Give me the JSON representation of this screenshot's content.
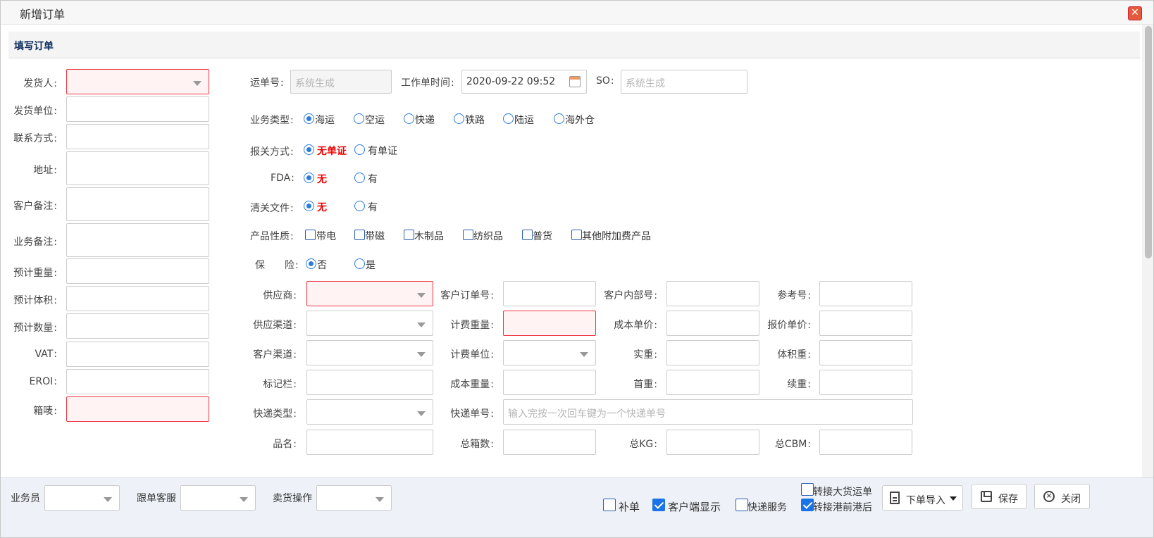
{
  "window": {
    "title": "新增订单"
  },
  "panel": {
    "title": "填写订单"
  },
  "left": {
    "shipper": "发货人",
    "shipper_unit": "发货单位",
    "contact": "联系方式",
    "address": "地址",
    "customer_note": "客户备注",
    "business_note": "业务备注",
    "est_weight": "预计重量",
    "est_volume": "预计体积",
    "est_qty": "预计数量",
    "vat": "VAT",
    "eori": "EROI",
    "marks": "箱唛"
  },
  "top": {
    "waybill_label": "运单号",
    "waybill_ph": "系统生成",
    "worktime_label": "工作单时间",
    "worktime_value": "2020-09-22 09:52",
    "so_label": "SO",
    "so_ph": "系统生成"
  },
  "biz": {
    "label": "业务类型",
    "options": [
      "海运",
      "空运",
      "快递",
      "铁路",
      "陆运",
      "海外仓"
    ]
  },
  "customs": {
    "label": "报关方式",
    "options": [
      "无单证",
      "有单证"
    ]
  },
  "fda": {
    "label": "FDA",
    "options": [
      "无",
      "有"
    ]
  },
  "clearance": {
    "label": "清关文件",
    "options": [
      "无",
      "有"
    ]
  },
  "product": {
    "label": "产品性质",
    "options": [
      "带电",
      "带磁",
      "木制品",
      "纺织品",
      "普货",
      "其他附加费产品"
    ]
  },
  "insurance": {
    "label": "保　　险",
    "options": [
      "否",
      "是"
    ]
  },
  "grid": {
    "supplier": "供应商",
    "cust_order": "客户订单号",
    "cust_inner": "客户内部号",
    "ref": "参考号",
    "supply_ch": "供应渠道",
    "charge_wt": "计费重量",
    "cost_price": "成本单价",
    "quote_price": "报价单价",
    "cust_ch": "客户渠道",
    "charge_unit": "计费单位",
    "actual_wt": "实重",
    "vol_wt": "体积重",
    "mark_col": "标记栏",
    "cost_wt": "成本重量",
    "first_wt": "首重",
    "cont_wt": "续重",
    "exp_type": "快递类型",
    "exp_no": "快递单号",
    "exp_no_ph": "输入完按一次回车键为一个快递单号",
    "product_name": "品名",
    "total_boxes": "总箱数",
    "total_kg": "总KG",
    "total_cbm": "总CBM"
  },
  "footer": {
    "salesman": "业务员",
    "cs": "跟单客服",
    "ops": "卖货操作",
    "chk_supplement": "补单",
    "chk_client_show": "客户端显示",
    "chk_express": "快递服务",
    "chk_bulk": "转接大货运单",
    "chk_pre_port": "转接港前港后",
    "import_btn": "下单导入",
    "save_btn": "保存",
    "close_btn": "关闭"
  }
}
